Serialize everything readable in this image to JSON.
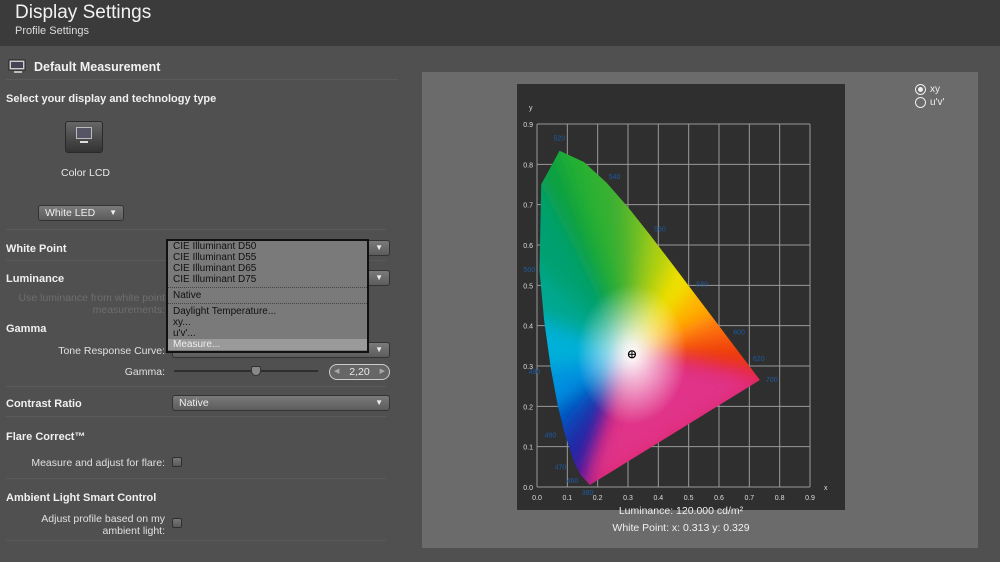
{
  "header": {
    "title": "Display Settings",
    "subtitle": "Profile Settings"
  },
  "left": {
    "section_title": "Default Measurement",
    "select_prompt": "Select your display and technology type",
    "display_name": "Color LCD",
    "technology": "White LED",
    "white_point": {
      "label": "White Point",
      "menu": [
        "CIE Illuminant D50",
        "CIE Illuminant D55",
        "CIE Illuminant D65",
        "CIE Illuminant D75",
        "Native",
        "Daylight Temperature...",
        "xy...",
        "u'v'...",
        "Measure..."
      ],
      "highlighted": "Measure..."
    },
    "luminance": {
      "label": "Luminance",
      "hint_line1": "Use luminance from white point",
      "hint_line2": "measurements:"
    },
    "gamma": {
      "label": "Gamma",
      "trc_label": "Tone Response Curve:",
      "gamma_label": "Gamma:",
      "gamma_value": "2,20",
      "slider_fraction": 0.57
    },
    "contrast": {
      "label": "Contrast Ratio",
      "value": "Native"
    },
    "flare": {
      "label": "Flare Correct™",
      "option": "Measure and adjust for flare:",
      "checked": false
    },
    "ambient": {
      "label": "Ambient Light Smart Control",
      "option_line1": "Adjust profile based on my",
      "option_line2": "ambient light:",
      "checked": false
    }
  },
  "right": {
    "radio": {
      "options": [
        "xy",
        "u'v'"
      ],
      "selected": "xy"
    },
    "luminance_text": "Luminance: 120.000 cd/m²",
    "white_point_text": "White Point: x: 0.313  y: 0.329"
  },
  "chart_data": {
    "type": "scatter",
    "xlabel": "x",
    "ylabel": "y",
    "xlim": [
      0,
      0.9
    ],
    "ylim": [
      0,
      0.9
    ],
    "grid": true,
    "xticks": [
      "0.0",
      "0.1",
      "0.2",
      "0.3",
      "0.4",
      "0.5",
      "0.6",
      "0.7",
      "0.8",
      "0.9"
    ],
    "yticks": [
      "0.0",
      "0.1",
      "0.2",
      "0.3",
      "0.4",
      "0.5",
      "0.6",
      "0.7",
      "0.8",
      "0.9"
    ],
    "wavelength_labels": [
      {
        "label": "380",
        "x": 0.174,
        "y": 0.005
      },
      {
        "label": "460",
        "x": 0.144,
        "y": 0.03
      },
      {
        "label": "470",
        "x": 0.124,
        "y": 0.058
      },
      {
        "label": "480",
        "x": 0.091,
        "y": 0.133
      },
      {
        "label": "490",
        "x": 0.045,
        "y": 0.295
      },
      {
        "label": "500",
        "x": 0.008,
        "y": 0.538
      },
      {
        "label": "520",
        "x": 0.074,
        "y": 0.834
      },
      {
        "label": "540",
        "x": 0.23,
        "y": 0.754
      },
      {
        "label": "560",
        "x": 0.373,
        "y": 0.624
      },
      {
        "label": "580",
        "x": 0.512,
        "y": 0.487
      },
      {
        "label": "600",
        "x": 0.627,
        "y": 0.373
      },
      {
        "label": "620",
        "x": 0.692,
        "y": 0.308
      },
      {
        "label": "700",
        "x": 0.735,
        "y": 0.265
      }
    ],
    "white_point": {
      "x": 0.313,
      "y": 0.329
    },
    "label_color": "#1e5aa0"
  }
}
